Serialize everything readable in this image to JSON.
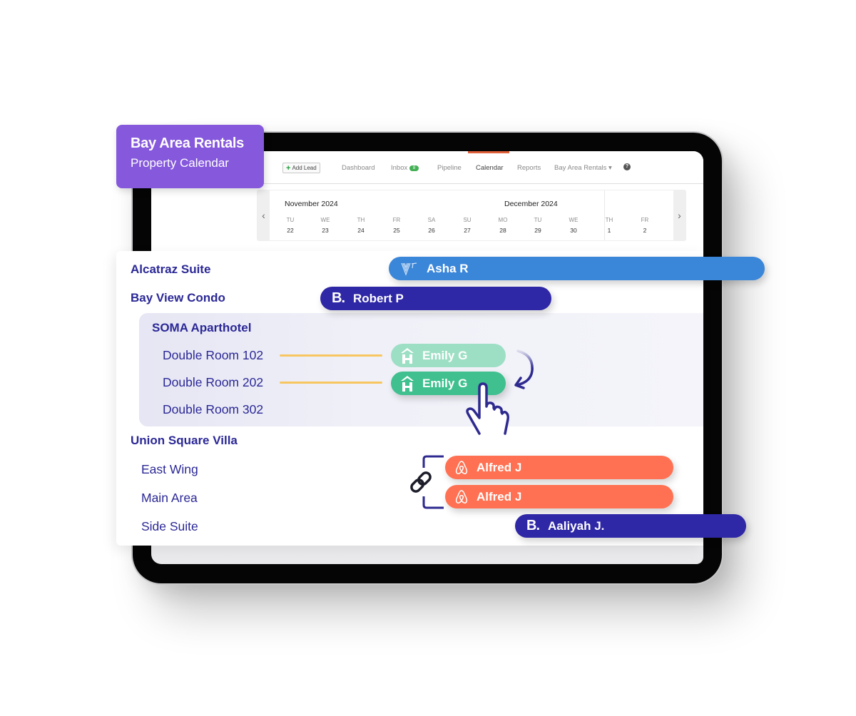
{
  "header_badge": {
    "title": "Bay Area Rentals",
    "subtitle": "Property Calendar",
    "color": "#8558dc"
  },
  "topnav": {
    "add_lead": "Add Lead",
    "links": [
      {
        "label": "Dashboard"
      },
      {
        "label": "Inbox",
        "badge": "8"
      },
      {
        "label": "Pipeline"
      },
      {
        "label": "Calendar",
        "active": true
      },
      {
        "label": "Reports"
      },
      {
        "label": "Bay Area Rentals ▾"
      }
    ],
    "help_icon": "?"
  },
  "calendar": {
    "prev_icon": "‹",
    "next_icon": "›",
    "months": [
      "November 2024",
      "December 2024"
    ],
    "days": [
      {
        "dow": "TU",
        "num": "22"
      },
      {
        "dow": "WE",
        "num": "23"
      },
      {
        "dow": "TH",
        "num": "24"
      },
      {
        "dow": "FR",
        "num": "25"
      },
      {
        "dow": "SA",
        "num": "26"
      },
      {
        "dow": "SU",
        "num": "27"
      },
      {
        "dow": "MO",
        "num": "28"
      },
      {
        "dow": "TU",
        "num": "29"
      },
      {
        "dow": "WE",
        "num": "30"
      },
      {
        "dow": "TH",
        "num": "1"
      },
      {
        "dow": "FR",
        "num": "2"
      }
    ]
  },
  "properties": [
    {
      "name": "Alcatraz Suite"
    },
    {
      "name": "Bay View Condo"
    },
    {
      "name": "SOMA Aparthotel",
      "units": [
        "Double Room 102",
        "Double Room 202",
        "Double Room 302"
      ]
    },
    {
      "name": "Union Square Villa",
      "units": [
        "East Wing",
        "Main Area",
        "Side Suite"
      ]
    }
  ],
  "bookings": [
    {
      "guest": "Asha R",
      "channel": "vrbo",
      "color": "#3a86d8"
    },
    {
      "guest": "Robert P",
      "channel": "booking.com",
      "logo": "B.",
      "color": "#2e27a6"
    },
    {
      "guest": "Emily G",
      "channel": "homeaway",
      "color": "#9ddfc4"
    },
    {
      "guest": "Emily G",
      "channel": "homeaway",
      "color": "#3fc08e"
    },
    {
      "guest": "Alfred J",
      "channel": "airbnb",
      "color": "#ff7152"
    },
    {
      "guest": "Alfred J",
      "channel": "airbnb",
      "color": "#ff7152"
    },
    {
      "guest": "Aaliyah J.",
      "channel": "booking.com",
      "logo": "B.",
      "color": "#2e27a6"
    }
  ]
}
